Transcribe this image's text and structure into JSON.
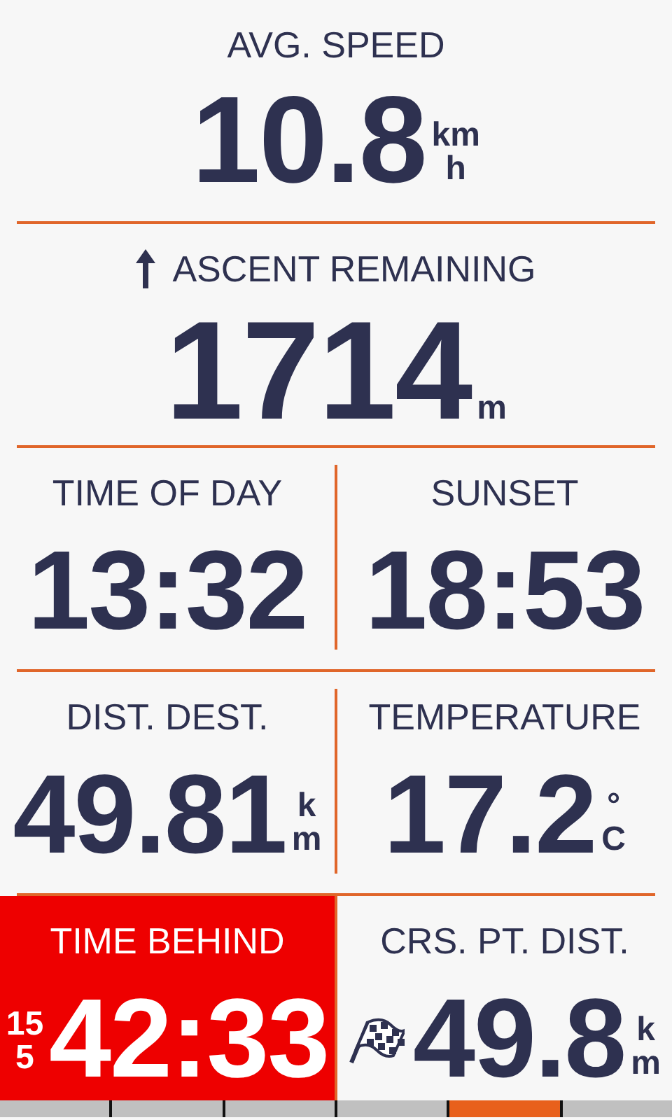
{
  "rows": [
    {
      "fields": [
        {
          "label": "AVG. SPEED",
          "value": "10.8",
          "unit": [
            "km",
            "h"
          ],
          "alert": false
        }
      ]
    },
    {
      "fields": [
        {
          "label": "ASCENT REMAINING",
          "kind": "ascent",
          "value": "1714",
          "unit": [
            "m"
          ],
          "alert": false
        }
      ]
    },
    {
      "fields": [
        {
          "label": "TIME OF DAY",
          "value": "13:32",
          "alert": false
        },
        {
          "label": "SUNSET",
          "value": "18:53",
          "alert": false
        }
      ]
    },
    {
      "fields": [
        {
          "label": "DIST. DEST.",
          "value": "49.81",
          "unit": [
            "k",
            "m"
          ],
          "alert": false
        },
        {
          "label": "TEMPERATURE",
          "value": "17.2",
          "unit": [
            "°",
            "C"
          ],
          "alert": false
        }
      ]
    },
    {
      "fields": [
        {
          "label": "TIME BEHIND",
          "prefix": [
            "15",
            "5"
          ],
          "value": "42:33",
          "alert": true
        },
        {
          "label": "CRS. PT. DIST.",
          "kind": "course-point",
          "value": "49.8",
          "unit": [
            "k",
            "m"
          ],
          "alert": false
        }
      ]
    }
  ],
  "pages": [
    {
      "selected": false
    },
    {
      "selected": false
    },
    {
      "selected": false
    },
    {
      "selected": false
    },
    {
      "selected": true
    },
    {
      "selected": false
    }
  ]
}
